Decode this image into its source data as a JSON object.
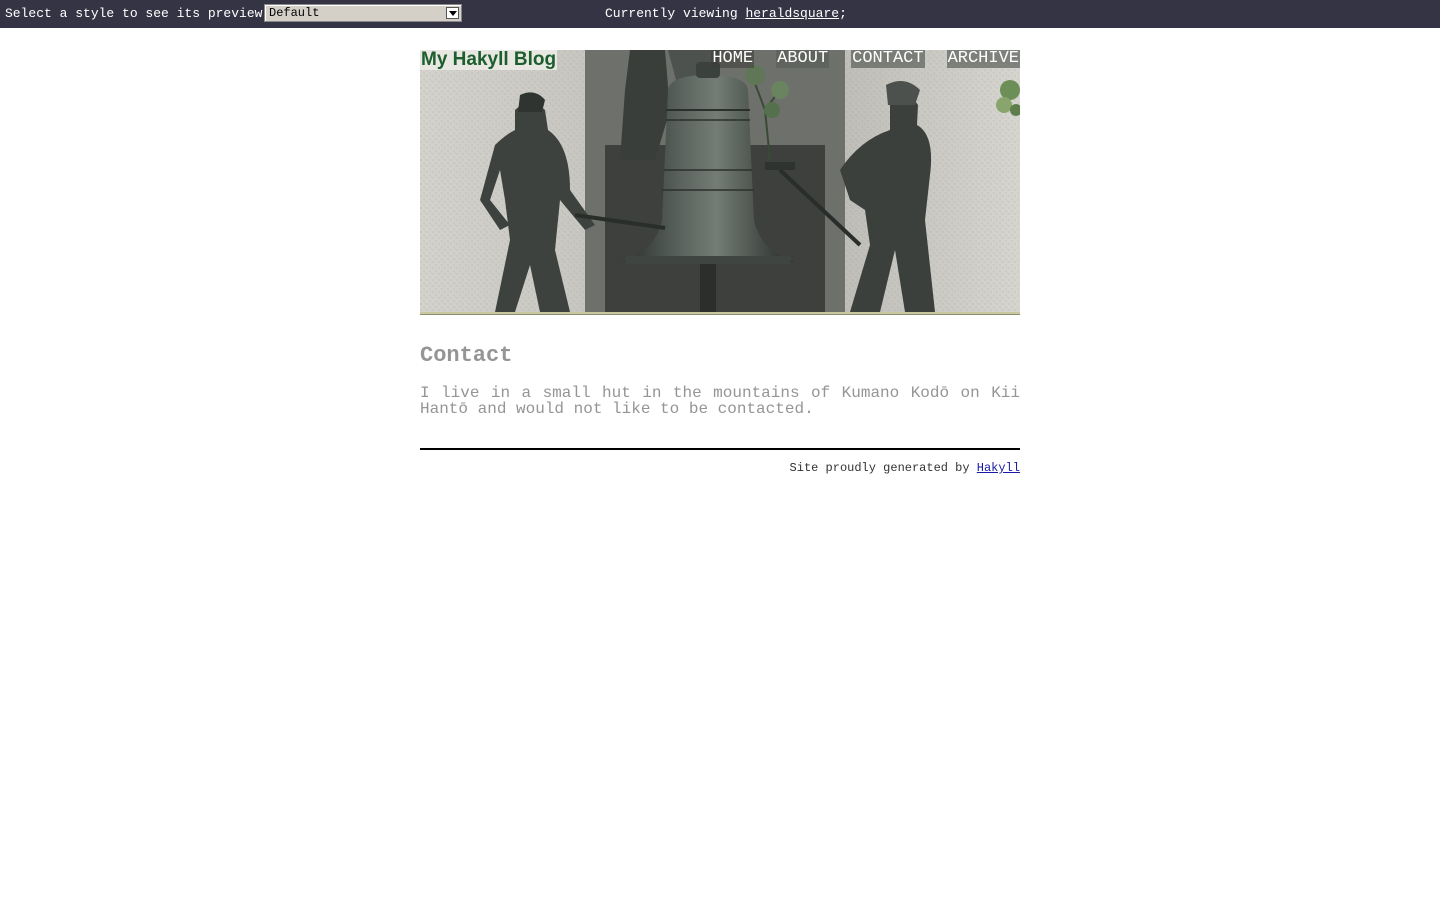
{
  "style_bar": {
    "select_label": "Select a style to see its preview:",
    "selected_style": "Default",
    "viewing_prefix": "Currently viewing ",
    "viewing_name": "heraldsquare",
    "viewing_suffix": ";"
  },
  "header": {
    "site_title": "My Hakyll Blog",
    "nav": [
      "HOME",
      "ABOUT",
      "CONTACT",
      "ARCHIVE"
    ]
  },
  "main": {
    "title": "Contact",
    "body": "I live in a small hut in the mountains of Kumano Kodō on Kii Hantō and would not like to be contacted."
  },
  "footer": {
    "prefix": "Site proudly generated by ",
    "link": "Hakyll"
  },
  "colors": {
    "topbar_bg": "#353445",
    "logo_green": "#1c5e2e",
    "text_gray": "#959595",
    "link_blue": "#1a1aa6"
  }
}
